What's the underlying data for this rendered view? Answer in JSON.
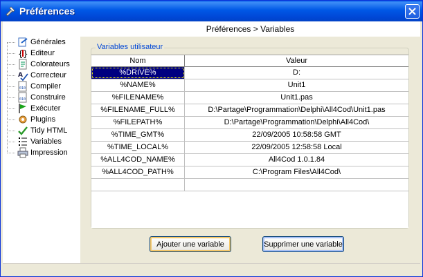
{
  "window": {
    "title": "Préférences",
    "accent": "#0058e6"
  },
  "tree": {
    "items": [
      {
        "label": "Générales",
        "icon": "general-settings-icon"
      },
      {
        "label": "Editeur",
        "icon": "braces-icon"
      },
      {
        "label": "Colorateurs",
        "icon": "color-document-icon"
      },
      {
        "label": "Correcteur",
        "icon": "spellcheck-icon"
      },
      {
        "label": "Compiler",
        "icon": "binary-document-icon"
      },
      {
        "label": "Construire",
        "icon": "binary-document-icon"
      },
      {
        "label": "Exécuter",
        "icon": "green-flag-icon"
      },
      {
        "label": "Plugins",
        "icon": "plugin-gear-icon"
      },
      {
        "label": "Tidy HTML",
        "icon": "checkmark-icon"
      },
      {
        "label": "Variables",
        "icon": "list-icon"
      },
      {
        "label": "Impression",
        "icon": "printer-icon"
      }
    ]
  },
  "breadcrumb": "Préférences > Variables",
  "group": {
    "legend": "Variables utilisateur"
  },
  "grid": {
    "columns": [
      "Nom",
      "Valeur"
    ],
    "rows": [
      {
        "name": "%DRIVE%",
        "value": "D:"
      },
      {
        "name": "%NAME%",
        "value": "Unit1"
      },
      {
        "name": "%FILENAME%",
        "value": "Unit1.pas"
      },
      {
        "name": "%FILENAME_FULL%",
        "value": "D:\\Partage\\Programmation\\Delphi\\All4Cod\\Unit1.pas"
      },
      {
        "name": "%FILEPATH%",
        "value": "D:\\Partage\\Programmation\\Delphi\\All4Cod\\"
      },
      {
        "name": "%TIME_GMT%",
        "value": "22/09/2005 10:58:58 GMT"
      },
      {
        "name": "%TIME_LOCAL%",
        "value": "22/09/2005 12:58:58 Local"
      },
      {
        "name": "%ALL4COD_NAME%",
        "value": "All4Cod 1.0.1.84"
      },
      {
        "name": "%ALL4COD_PATH%",
        "value": "C:\\Program Files\\All4Cod\\"
      },
      {
        "name": "",
        "value": ""
      }
    ],
    "selected_row_color": "#000080"
  },
  "buttons": {
    "add": "Ajouter une variable",
    "delete": "Supprimer une variable"
  }
}
